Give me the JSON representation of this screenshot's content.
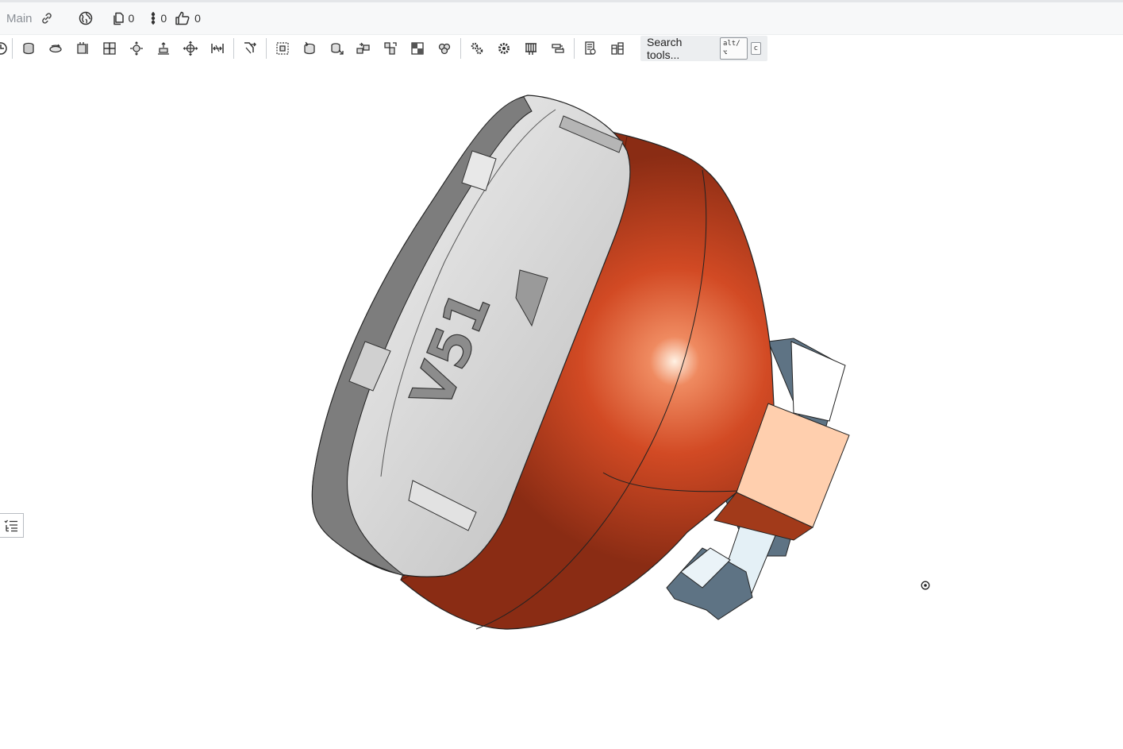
{
  "header": {
    "document_name": "Main",
    "counts": {
      "files": "0",
      "versions": "0",
      "likes": "0"
    }
  },
  "icons": {
    "link": "link-icon",
    "public": "globe-icon",
    "files": "document-copy-icon",
    "versions": "version-dots-icon",
    "likes": "thumbs-up-icon"
  },
  "toolbar": {
    "search_placeholder": "Search tools...",
    "shortcut_modifier": "alt/⌥",
    "shortcut_key": "c"
  },
  "model": {
    "engraving": "V51",
    "colors": {
      "ring": "#d9d9d9",
      "housing": "#cc4422",
      "bracket": "#5e7384",
      "block": "#ffcfae"
    }
  },
  "side_panel": {
    "icon": "feature-list-icon"
  }
}
